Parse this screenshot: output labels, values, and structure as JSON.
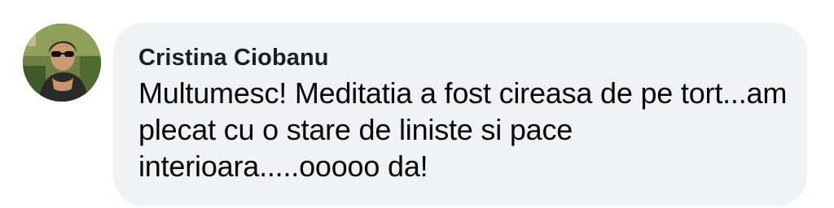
{
  "comment": {
    "author": "Cristina Ciobanu",
    "text": "Multumesc! Meditatia a fost cireasa de pe tort...am plecat cu o stare de liniste si pace interioara.....ooooo da!",
    "avatar_icon": "user-photo-avatar"
  },
  "colors": {
    "bubble_background": "#f0f2f5",
    "author_text": "#1c1e21",
    "body_text": "#050505"
  }
}
